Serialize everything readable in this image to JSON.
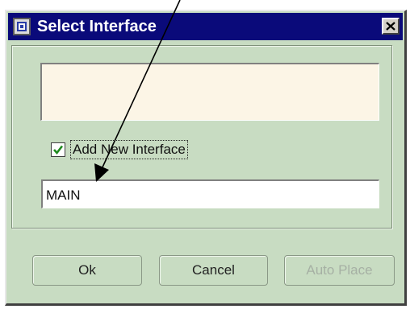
{
  "dialog": {
    "title": "Select Interface",
    "app_icon": "interface-window-icon",
    "close_icon": "close-x-icon"
  },
  "interface_list": {
    "items": []
  },
  "add_new_interface": {
    "label": "Add New Interface",
    "checked": true
  },
  "interface_name": {
    "value": "MAIN"
  },
  "buttons": {
    "ok": "Ok",
    "cancel": "Cancel",
    "auto_place": "Auto Place",
    "auto_place_enabled": false
  },
  "annotation": {
    "icon": "arrow-annotation"
  },
  "colors": {
    "title_bar": "#0a0a7a",
    "dialog_background": "#c8dcc2",
    "list_background": "#fcf5e6",
    "check_mark": "#1e8a1e"
  }
}
